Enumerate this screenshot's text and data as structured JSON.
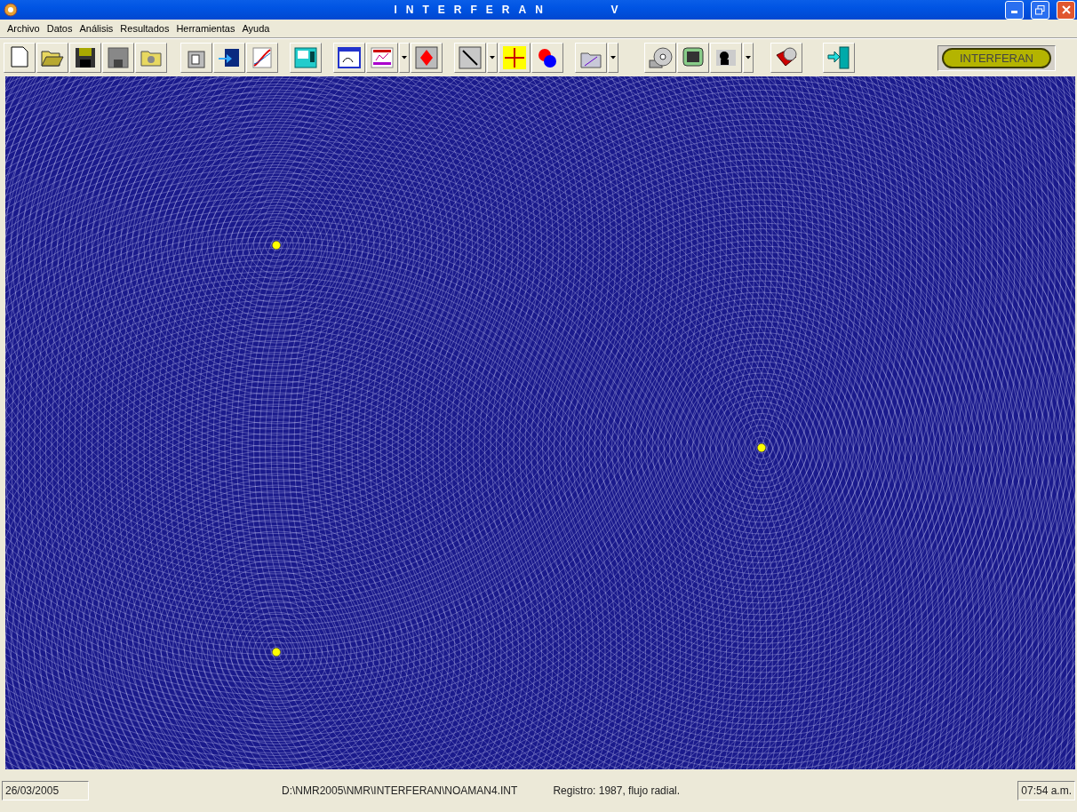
{
  "window": {
    "title": "INTERFERAN     V"
  },
  "menu": [
    "Archivo",
    "Datos",
    "Análisis",
    "Resultados",
    "Herramientas",
    "Ayuda"
  ],
  "toolbar": {
    "badge": "INTERFERAN"
  },
  "status_bar": {
    "date": "26/03/2005",
    "path": "D:\\NMR2005\\NMR\\INTERFERAN\\NOAMAN4.INT",
    "record": "Registro: 1987, flujo radial.",
    "time": "07:54 a.m."
  }
}
